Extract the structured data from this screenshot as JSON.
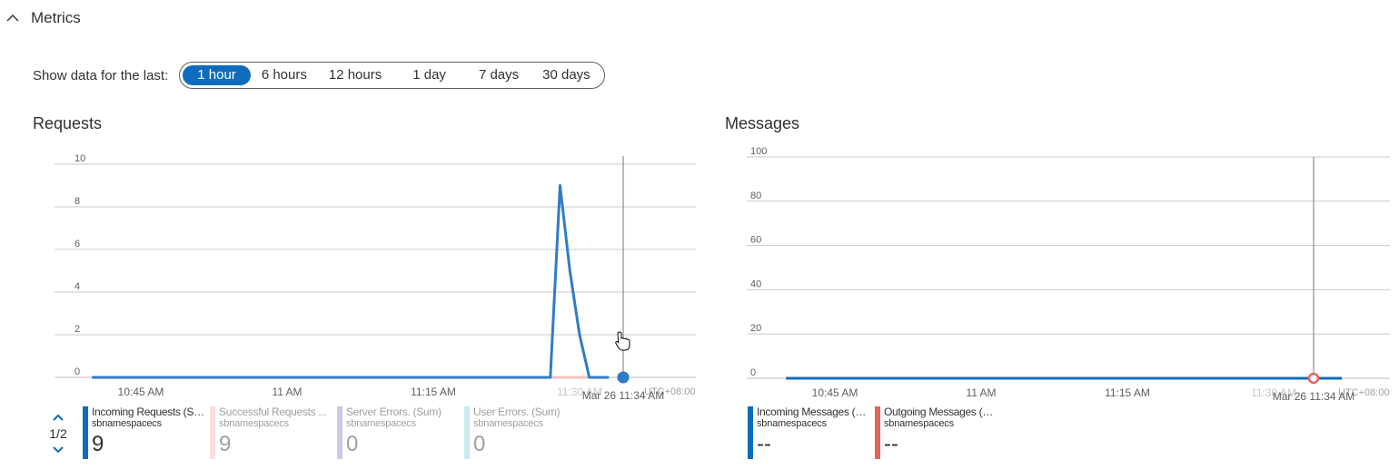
{
  "section": {
    "title": "Metrics",
    "expanded": true,
    "icon": "chevron-up-icon"
  },
  "time_range": {
    "label": "Show data for the last:",
    "options": [
      "1 hour",
      "6 hours",
      "12 hours",
      "1 day",
      "7 days",
      "30 days"
    ],
    "selected": "1 hour"
  },
  "pager": {
    "text": "1/2",
    "up_icon": "chevron-up-icon",
    "down_icon": "chevron-down-icon"
  },
  "chart_data": [
    {
      "type": "line",
      "title": "Requests",
      "xlabel": "",
      "ylabel": "",
      "ylim": [
        0,
        10
      ],
      "yticks": [
        "10",
        "8",
        "6",
        "4",
        "2",
        "0"
      ],
      "xtick_labels": [
        "10:45 AM",
        "11 AM",
        "11:15 AM",
        "11:30 AM"
      ],
      "x_minutes": [
        0,
        15,
        30,
        45
      ],
      "timezone_label": "UTC+08:00",
      "cursor_label": "Mar 26 11:34 AM",
      "grid": true,
      "series": [
        {
          "name": "Incoming Requests (Sum)",
          "color": "#2f7cc4",
          "x": [
            -5,
            41,
            42,
            43,
            44,
            45,
            46,
            47,
            48
          ],
          "values": [
            0,
            0,
            0,
            9,
            5,
            2,
            0,
            0,
            0
          ]
        },
        {
          "name": "Successful Requests (Sum)",
          "color": "#f5c2bd",
          "x": [
            -5,
            48
          ],
          "values": [
            0,
            0
          ]
        },
        {
          "name": "Server Errors. (Sum)",
          "color": "#9aa0cc",
          "x": [
            -5,
            48
          ],
          "values": [
            0,
            0
          ]
        },
        {
          "name": "User Errors. (Sum)",
          "color": "#9fd7e3",
          "x": [
            -5,
            48
          ],
          "values": [
            0,
            0
          ]
        }
      ],
      "legend": [
        {
          "name": "Incoming Requests (Sum)",
          "namespace": "sbnamespacecs",
          "value": "9",
          "color": "#0f6cbd",
          "dim": false
        },
        {
          "name": "Successful Requests ...",
          "namespace": "sbnamespacecs",
          "value": "9",
          "color": "#f5c2bd",
          "dim": true
        },
        {
          "name": "Server Errors. (Sum)",
          "namespace": "sbnamespacecs",
          "value": "0",
          "color": "#9aa0cc",
          "dim": true
        },
        {
          "name": "User Errors. (Sum)",
          "namespace": "sbnamespacecs",
          "value": "0",
          "color": "#9fd7e3",
          "dim": true
        }
      ]
    },
    {
      "type": "line",
      "title": "Messages",
      "xlabel": "",
      "ylabel": "",
      "ylim": [
        0,
        100
      ],
      "yticks": [
        "100",
        "80",
        "60",
        "40",
        "20",
        "0"
      ],
      "xtick_labels": [
        "10:45 AM",
        "11 AM",
        "11:15 AM",
        "11:30 AM"
      ],
      "x_minutes": [
        0,
        15,
        30,
        45
      ],
      "timezone_label": "UTC+08:00",
      "cursor_label": "Mar 26 11:34 AM",
      "grid": true,
      "series": [
        {
          "name": "Incoming Messages (Sum)",
          "color": "#0f6cbd",
          "x": [
            -5,
            52
          ],
          "values": [
            0,
            0
          ]
        },
        {
          "name": "Outgoing Messages (Sum)",
          "color": "#e8645a",
          "x": [
            -5,
            52
          ],
          "values": [
            0,
            0
          ]
        }
      ],
      "legend": [
        {
          "name": "Incoming Messages (Sum)",
          "namespace": "sbnamespacecs",
          "value": "--",
          "color": "#0f6cbd",
          "dim": false
        },
        {
          "name": "Outgoing Messages (Sum)",
          "namespace": "sbnamespacecs",
          "value": "--",
          "color": "#e8645a",
          "dim": false
        }
      ]
    }
  ]
}
